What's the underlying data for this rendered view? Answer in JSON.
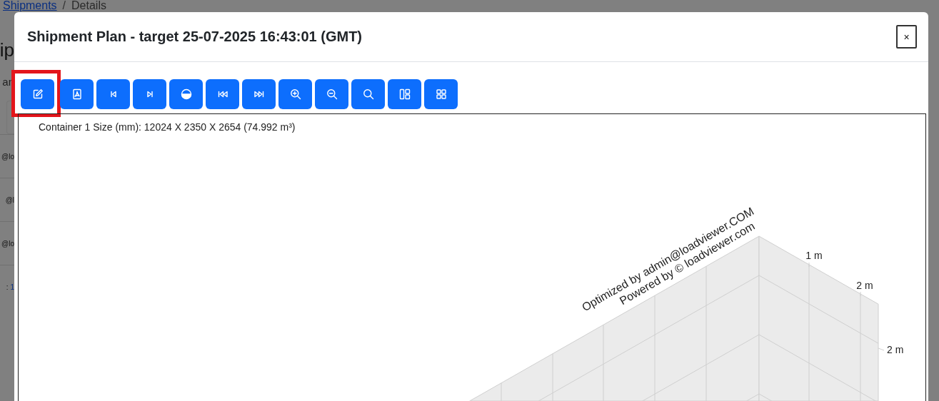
{
  "breadcrumb": {
    "link": "Shipments",
    "separator": "/",
    "current": "Details"
  },
  "background_page": {
    "heading": "ip",
    "subtitle": "an",
    "rows": [
      "@lo",
      "@l",
      "@lo"
    ],
    "footer_label": ":",
    "footer_value": "1"
  },
  "modal": {
    "title": "Shipment Plan - target 25-07-2025 16:43:01 (GMT)",
    "close": "×",
    "toolbar": [
      {
        "highlighted": true
      },
      {
        "highlighted": false
      },
      {
        "highlighted": false
      },
      {
        "highlighted": false
      },
      {
        "highlighted": false
      },
      {
        "highlighted": false
      },
      {
        "highlighted": false
      },
      {
        "highlighted": false
      },
      {
        "highlighted": false
      },
      {
        "highlighted": false
      },
      {
        "highlighted": false
      },
      {
        "highlighted": false
      }
    ],
    "container_info": "Container 1 Size (mm): 12024 X 2350 X 2654 (74.992 m³)",
    "credits": [
      "Optimized by admin@loadviewer.COM",
      "Powered by © loadviewer.com"
    ],
    "axis_labels": [
      "1 m",
      "2 m",
      "2 m"
    ]
  }
}
